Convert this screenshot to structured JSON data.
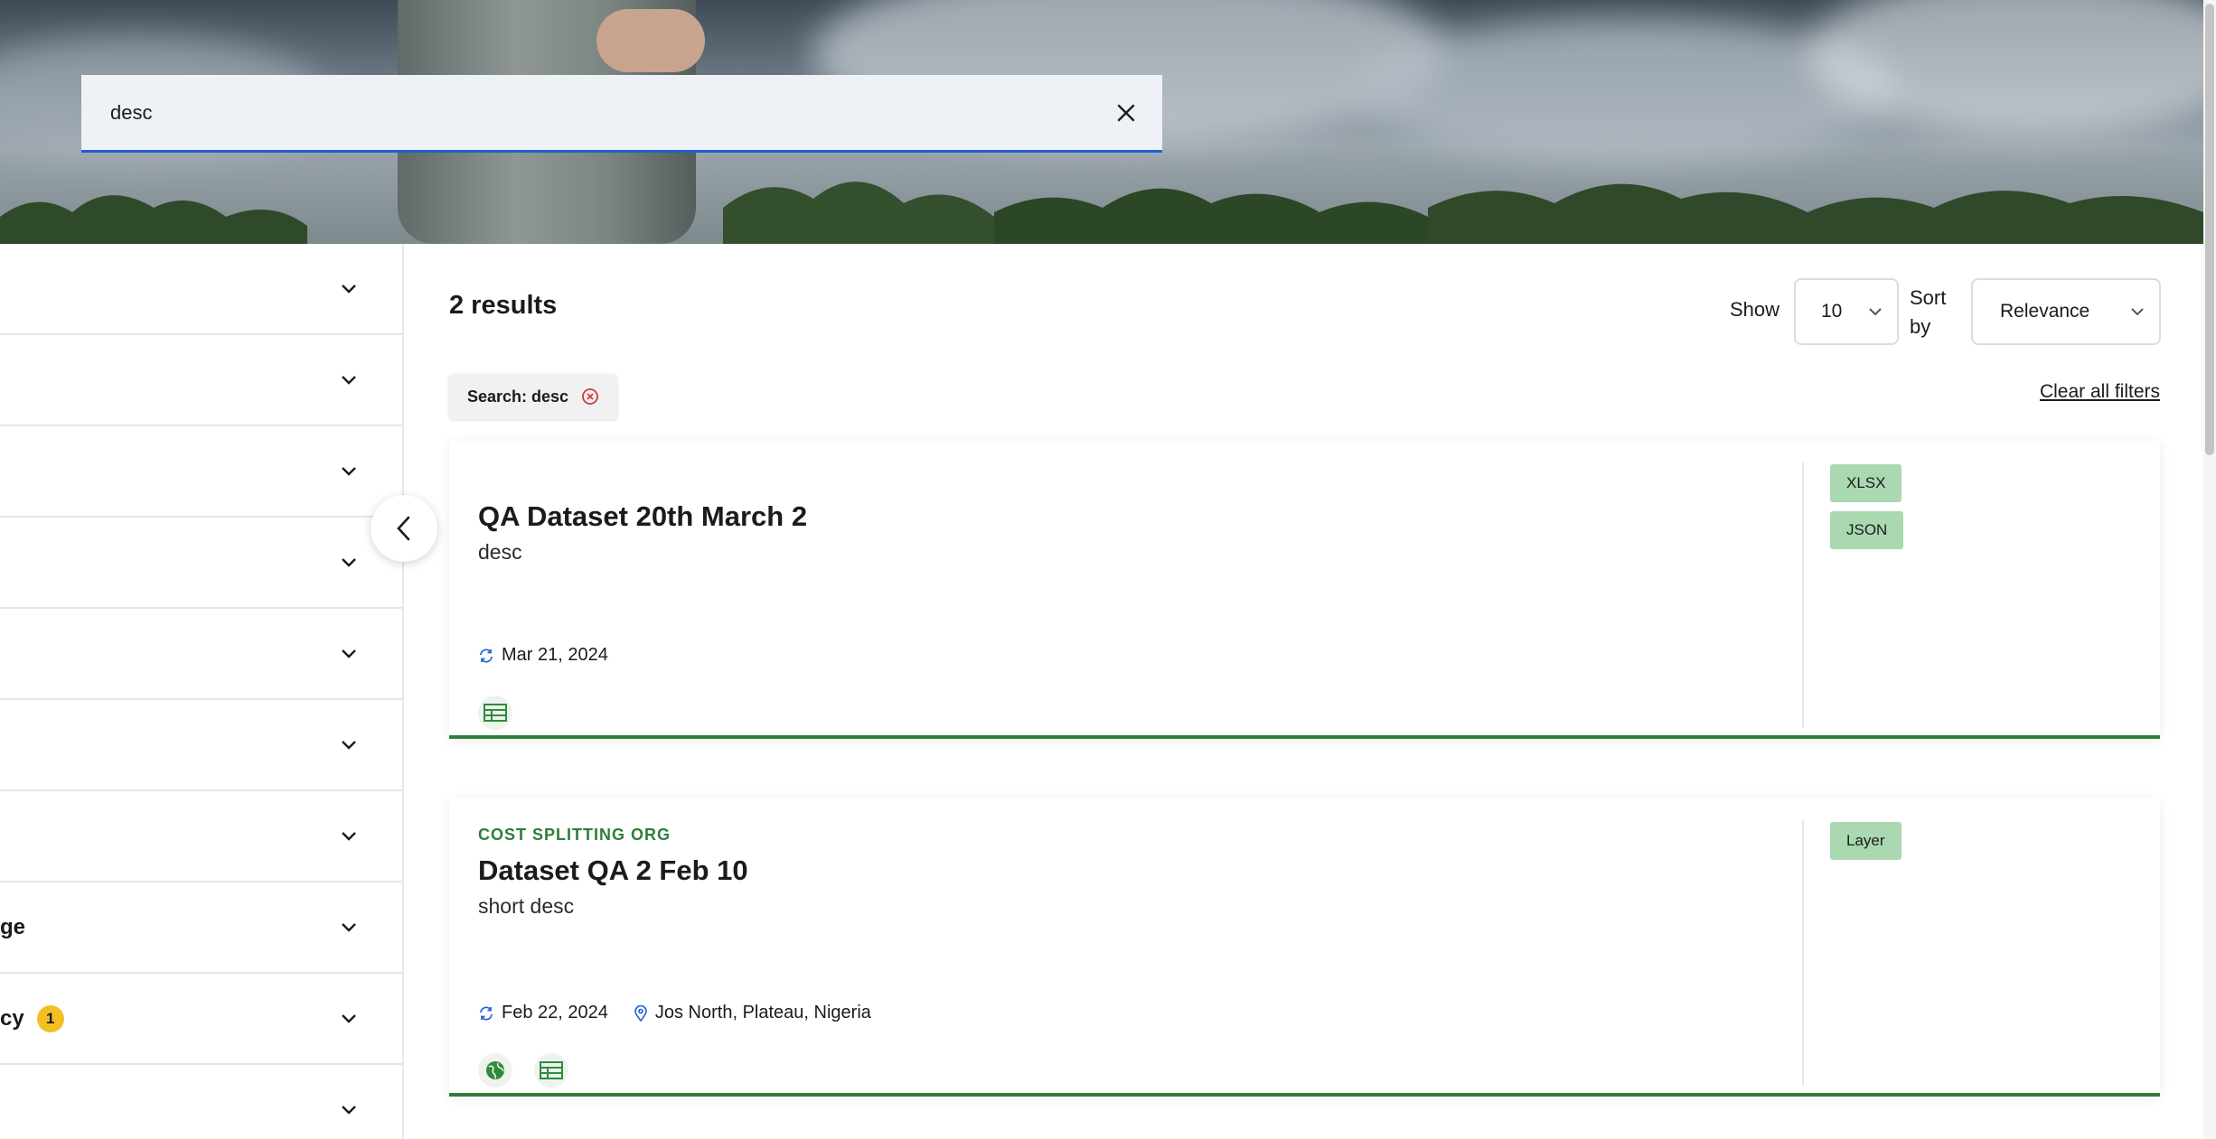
{
  "search": {
    "value": "desc",
    "clear_icon": "close-icon"
  },
  "sidebar": {
    "items": [
      {
        "label": ""
      },
      {
        "label": ""
      },
      {
        "label": ""
      },
      {
        "label": ""
      },
      {
        "label": ""
      },
      {
        "label": ""
      },
      {
        "label": ""
      },
      {
        "label": "ge"
      },
      {
        "label": "cy",
        "badge": "1"
      },
      {
        "label": ""
      }
    ],
    "collapse_icon": "chevron-left-icon"
  },
  "results": {
    "count_text": "2 results",
    "show_label": "Show",
    "show_value": "10",
    "sort_label": "Sort by",
    "sort_value": "Relevance",
    "chip_label": "Search: desc",
    "clear_all": "Clear all filters"
  },
  "datasets": [
    {
      "org": "",
      "title": "QA Dataset 20th March 2",
      "description": "desc",
      "updated": "Mar 21, 2024",
      "location": "",
      "formats": [
        "XLSX",
        "JSON"
      ],
      "type_icons": [
        "table-icon"
      ]
    },
    {
      "org": "COST SPLITTING ORG",
      "title": "Dataset QA 2 Feb 10",
      "description": "short desc",
      "updated": "Feb 22, 2024",
      "location": "Jos North, Plateau, Nigeria",
      "formats": [
        "Layer"
      ],
      "type_icons": [
        "globe-icon",
        "table-icon"
      ]
    }
  ],
  "colors": {
    "accent_green": "#2e7d3a",
    "format_badge": "#a9d8b1",
    "search_underline": "#1f5fd1",
    "badge_yellow": "#f2c025"
  }
}
